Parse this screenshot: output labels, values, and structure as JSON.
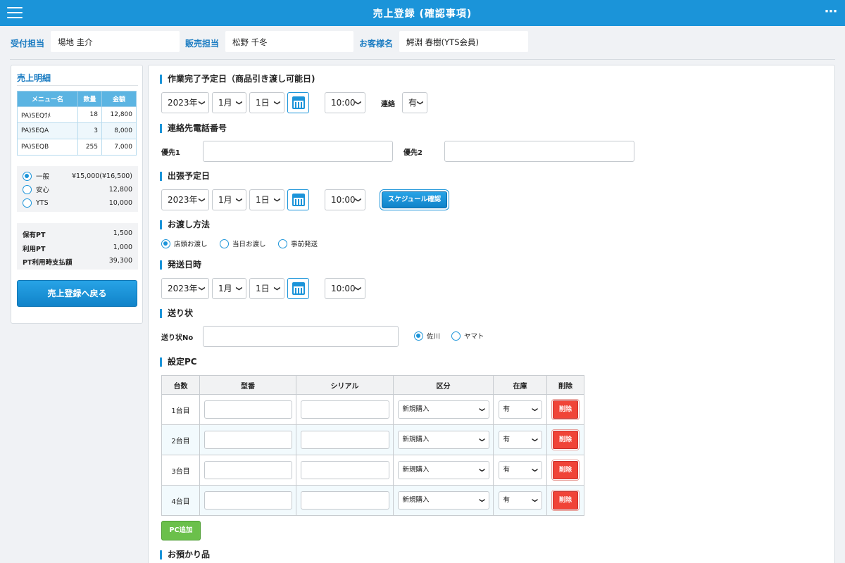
{
  "header": {
    "title": "売上登録 (確認事項)"
  },
  "staff": {
    "reception_label": "受付担当",
    "reception_value": "場地 圭介",
    "sales_label": "販売担当",
    "sales_value": "松野 千冬",
    "customer_label": "お客様名",
    "customer_value": "鰐淵 春樹(YTS会員)"
  },
  "sidebar": {
    "title": "売上明細",
    "table": {
      "headers": [
        "メニュー名",
        "数量",
        "金額"
      ],
      "rows": [
        [
          "PA)SEQｳﾒ",
          "18",
          "12,800"
        ],
        [
          "PA)SEQA",
          "3",
          "8,000"
        ],
        [
          "PA)SEQB",
          "255",
          "7,000"
        ]
      ]
    },
    "plans": [
      {
        "name": "一般",
        "value": "¥15,000(¥16,500)",
        "selected": true
      },
      {
        "name": "安心",
        "value": "12,800",
        "selected": false
      },
      {
        "name": "YTS",
        "value": "10,000",
        "selected": false
      }
    ],
    "points": [
      {
        "label": "保有PT",
        "value": "1,500"
      },
      {
        "label": "利用PT",
        "value": "1,000"
      },
      {
        "label": "PT利用時支払額",
        "value": "39,300"
      }
    ],
    "back_button": "売上登録へ戻る"
  },
  "main": {
    "completion": {
      "title": "作業完了予定日（商品引き渡し可能日)",
      "year": "2023年",
      "month": "1月",
      "day": "1日",
      "time": "10:00",
      "contact_label": "連絡",
      "contact_value": "有"
    },
    "phone": {
      "title": "連絡先電話番号",
      "priority1_label": "優先1",
      "priority2_label": "優先2"
    },
    "trip": {
      "title": "出張予定日",
      "year": "2023年",
      "month": "1月",
      "day": "1日",
      "time": "10:00",
      "schedule_button": "スケジュール確認"
    },
    "delivery": {
      "title": "お渡し方法",
      "options": [
        {
          "label": "店頭お渡し",
          "selected": true
        },
        {
          "label": "当日お渡し",
          "selected": false
        },
        {
          "label": "事前発送",
          "selected": false
        }
      ]
    },
    "shipping": {
      "title": "発送日時",
      "year": "2023年",
      "month": "1月",
      "day": "1日",
      "time": "10:00"
    },
    "invoice": {
      "title": "送り状",
      "no_label": "送り状No",
      "carriers": [
        {
          "label": "佐川",
          "selected": true
        },
        {
          "label": "ヤマト",
          "selected": false
        }
      ]
    },
    "pc": {
      "title": "設定PC",
      "headers": [
        "台数",
        "型番",
        "シリアル",
        "区分",
        "在庫",
        "削除"
      ],
      "rows": [
        {
          "label": "1台目",
          "category": "新規購入",
          "stock": "有",
          "delete": "削除"
        },
        {
          "label": "2台目",
          "category": "新規購入",
          "stock": "有",
          "delete": "削除"
        },
        {
          "label": "3台目",
          "category": "新規購入",
          "stock": "有",
          "delete": "削除"
        },
        {
          "label": "4台目",
          "category": "新規購入",
          "stock": "有",
          "delete": "削除"
        }
      ],
      "add_button": "PC追加"
    },
    "deposit": {
      "title": "お預かり品"
    }
  },
  "colors": {
    "accent": "#1b94d9",
    "delete": "#f04438",
    "add": "#6bc04b"
  }
}
